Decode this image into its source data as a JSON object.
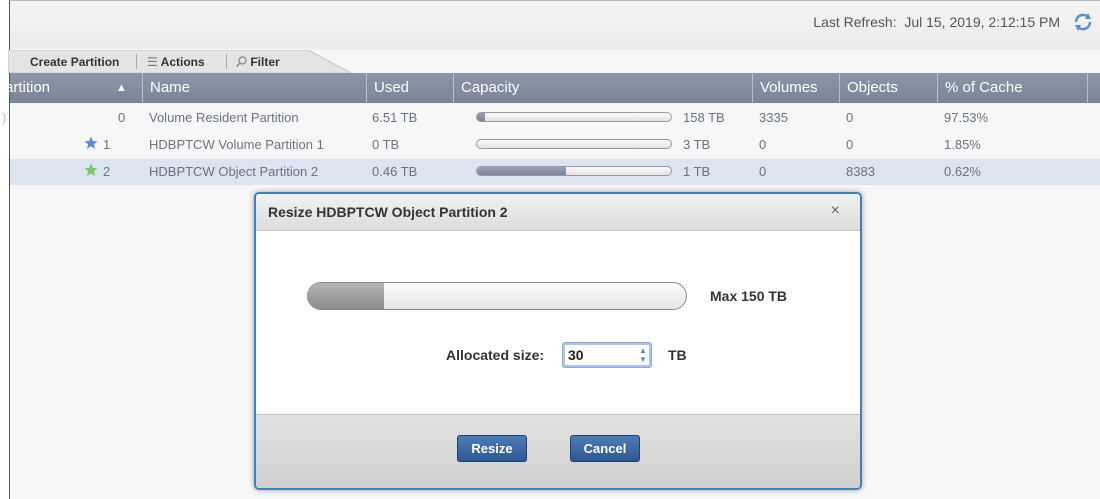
{
  "header": {
    "last_refresh_label": "Last Refresh:",
    "last_refresh_value": "Jul 15, 2019, 2:12:15 PM",
    "refresh_icon": "refresh-icon"
  },
  "toolbar": {
    "create_label": "Create Partition",
    "actions_label": "Actions",
    "filter_label": "Filter",
    "actions_icon": "list-icon",
    "filter_icon": "search-icon"
  },
  "table": {
    "columns": [
      "artition",
      "Name",
      "Used",
      "Capacity",
      "Volumes",
      "Objects",
      "% of Cache"
    ],
    "sort_indicator": "▲",
    "rows": [
      {
        "partition": "0",
        "name": "Volume Resident Partition",
        "used": "6.51 TB",
        "capacity": "158 TB",
        "capacity_fill": 0.04,
        "volumes": "3335",
        "objects": "0",
        "cache": "97.53%",
        "star": "none"
      },
      {
        "partition": "1",
        "name": "HDBPTCW Volume Partition 1",
        "used": "0 TB",
        "capacity": "3 TB",
        "capacity_fill": 0.0,
        "volumes": "0",
        "objects": "0",
        "cache": "1.85%",
        "star": "blue"
      },
      {
        "partition": "2",
        "name": "HDBPTCW Object Partition 2",
        "used": "0.46 TB",
        "capacity": "1 TB",
        "capacity_fill": 0.46,
        "volumes": "0",
        "objects": "8383",
        "cache": "0.62%",
        "star": "green",
        "selected": true
      }
    ]
  },
  "dialog": {
    "title": "Resize HDBPTCW Object Partition 2",
    "close_glyph": "×",
    "max_label": "Max 150 TB",
    "allocated_label": "Allocated size:",
    "allocated_value": "30",
    "allocated_fraction": 0.2,
    "unit": "TB",
    "resize_label": "Resize",
    "cancel_label": "Cancel"
  },
  "colors": {
    "header_bg": "#7f8a9d",
    "selected_row": "#dbe4ef",
    "dialog_border": "#3f7fc1",
    "button": "#3a65a3",
    "star_blue": "#5b8fd6",
    "star_green": "#7cc56a"
  }
}
